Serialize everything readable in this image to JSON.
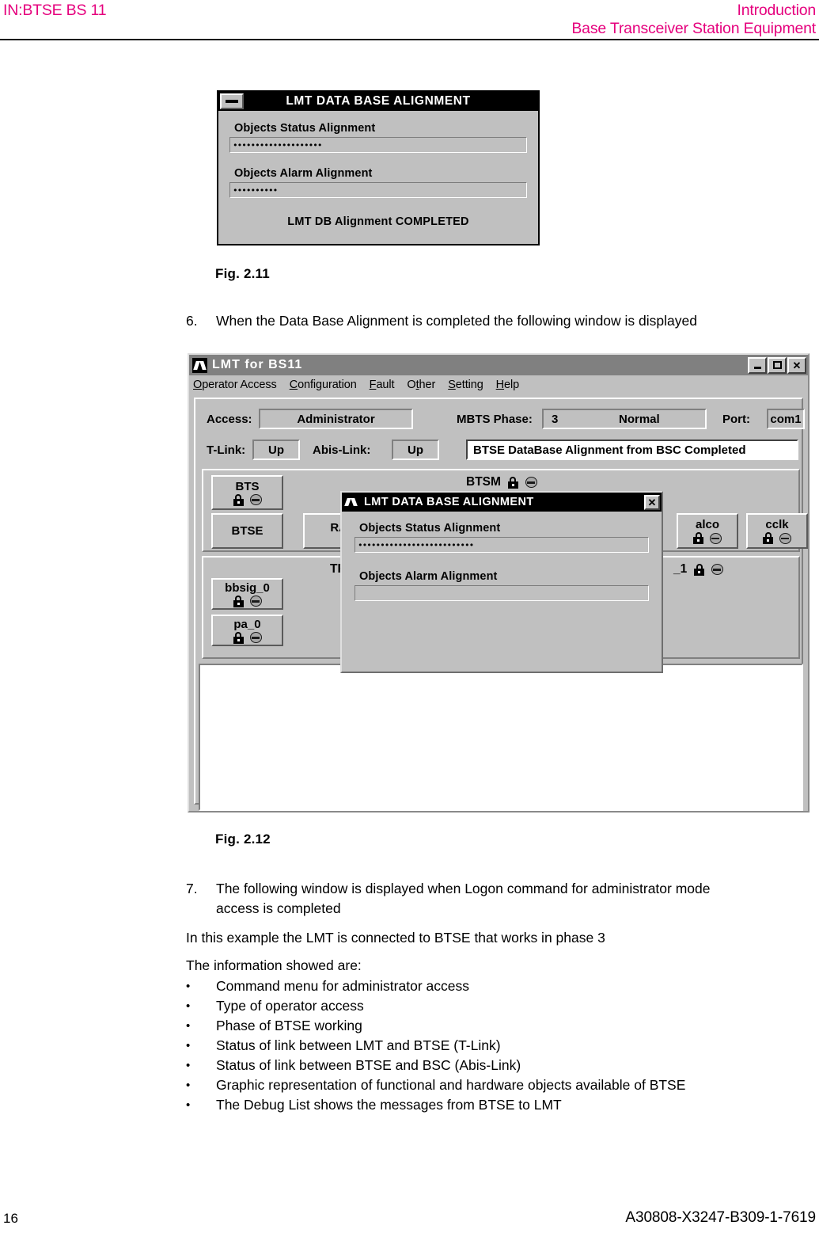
{
  "header": {
    "left": "IN:BTSE BS 11",
    "right_line1": "Introduction",
    "right_line2": "Base Transceiver Station Equipment",
    "color": "#e5007d"
  },
  "fig211": {
    "caption": "Fig.  2.11",
    "window": {
      "title": "LMT DATA BASE ALIGNMENT",
      "minimize_icon": "minimize-icon",
      "status_label": "Objects Status Alignment",
      "status_progress": "••••••••••••••••••••",
      "alarm_label": "Objects Alarm Alignment",
      "alarm_progress": "••••••••••",
      "completed_text": "LMT DB Alignment COMPLETED"
    }
  },
  "step6": {
    "number": "6.",
    "text": "When the Data Base Alignment is completed the following window is displayed"
  },
  "fig212": {
    "caption": "Fig.  2.12",
    "window": {
      "title": "LMT  for  BS11",
      "app_icon": "lmt-app-icon",
      "buttons": {
        "minimize": "minimize-icon",
        "maximize": "maximize-icon",
        "close": "✕"
      },
      "menu": [
        {
          "mnemonic": "O",
          "rest": "perator Access"
        },
        {
          "mnemonic": "C",
          "rest": "onfiguration"
        },
        {
          "mnemonic": "F",
          "rest": "ault"
        },
        {
          "mnemonic": "O",
          "rest": "ther",
          "pre": ""
        },
        {
          "mnemonic": "S",
          "rest": "etting"
        },
        {
          "mnemonic": "H",
          "rest": "elp"
        }
      ],
      "status": {
        "access_label": "Access:",
        "access_value": "Administrator",
        "mbts_label": "MBTS Phase:",
        "mbts_value": "3",
        "mbts_state": "Normal",
        "port_label": "Port:",
        "port_value": "com1",
        "tlink_label": "T-Link:",
        "tlink_value": "Up",
        "abislink_label": "Abis-Link:",
        "abislink_value": "Up",
        "message": "BTSE DataBase Alignment from BSC Completed"
      },
      "panel1": {
        "head": "BTSM",
        "nodes": [
          {
            "label": "BTS",
            "icons": true
          },
          {
            "label": "BTSE",
            "icons": false
          },
          {
            "label": "RACK",
            "icons": false
          },
          {
            "label": "alco",
            "icons": true
          },
          {
            "label": "cclk",
            "icons": true
          }
        ]
      },
      "panel2": {
        "head_left": "TR",
        "head_right": "_1",
        "nodes": [
          {
            "label": "bbsig_0",
            "icons": true
          },
          {
            "label": "pa_0",
            "icons": true
          }
        ]
      },
      "dialog": {
        "title": "LMT DATA BASE ALIGNMENT",
        "close": "✕",
        "status_label": "Objects Status Alignment",
        "status_progress": "••••••••••••••••••••••••••",
        "alarm_label": "Objects Alarm Alignment",
        "alarm_progress": ""
      }
    }
  },
  "step7": {
    "number": "7.",
    "line1": "The following window is displayed when Logon command for administrator mode",
    "line2": "access is completed"
  },
  "paragraphs": {
    "example": "In this example the LMT is connected to BTSE that works in phase 3",
    "info_intro": "The information showed are:"
  },
  "bullets": [
    "Command menu for administrator access",
    "Type of operator access",
    "Phase of BTSE working",
    "Status of link between LMT and BTSE (T-Link)",
    "Status of link between BTSE and BSC (Abis-Link)",
    "Graphic representation of functional and hardware objects available of BTSE",
    "The Debug List shows the messages from BTSE to LMT"
  ],
  "footer": {
    "page_number": "16",
    "doc_number": "A30808-X3247-B309-1-7619"
  }
}
